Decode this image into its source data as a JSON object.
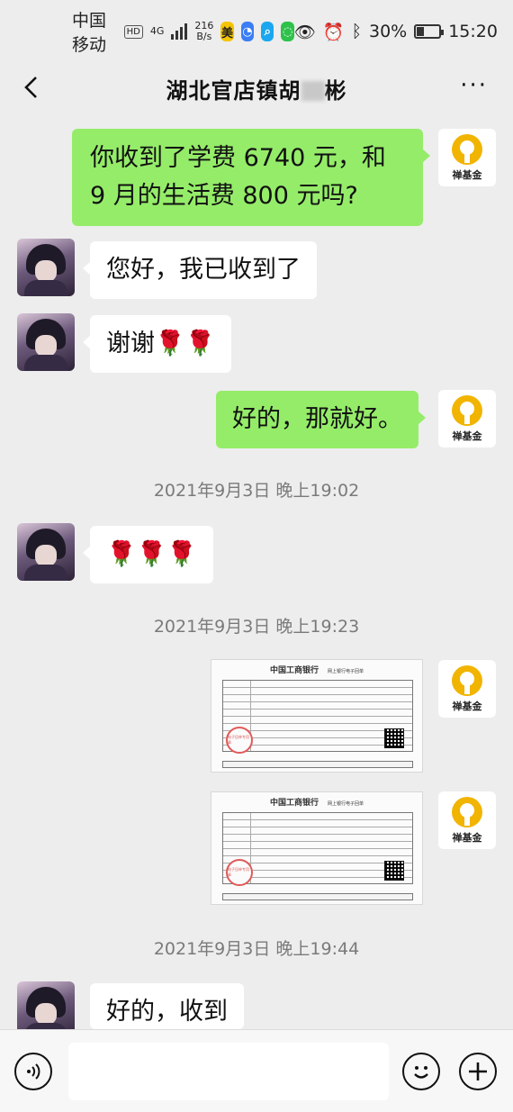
{
  "status_bar": {
    "carrier": "中国移动",
    "hd": "HD",
    "network": "4G",
    "speed_value": "216",
    "speed_unit": "B/s",
    "battery": "30%",
    "time": "15:20"
  },
  "header": {
    "title_part1": "湖北官店镇胡",
    "title_part2": "彬",
    "more": "···"
  },
  "me": {
    "avatar_label": "禅基金"
  },
  "messages": [
    {
      "line1": "你收到了学费 6740 元，和",
      "line2": "9 月的生活费 800 元吗?"
    },
    {
      "text": "您好，我已收到了"
    },
    {
      "text": "谢谢",
      "emoji": "🌹🌹"
    },
    {
      "text": "好的，那就好。"
    },
    {
      "emoji": "🌹🌹🌹"
    },
    {
      "text": "好的，收到"
    }
  ],
  "timestamps": [
    "2021年9月3日 晚上19:02",
    "2021年9月3日 晚上19:23",
    "2021年9月3日 晚上19:44"
  ],
  "receipt": {
    "bank_name": "中国工商银行",
    "subtitle": "网上银行电子回单",
    "stamp": "电子回单专用章"
  }
}
